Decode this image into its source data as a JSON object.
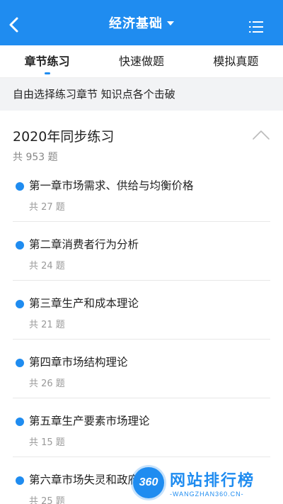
{
  "header": {
    "title": "经济基础"
  },
  "tabs": [
    {
      "label": "章节练习",
      "active": true
    },
    {
      "label": "快速做题",
      "active": false
    },
    {
      "label": "模拟真题",
      "active": false
    }
  ],
  "hint": "自由选择练习章节 知识点各个击破",
  "section": {
    "title": "2020年同步练习",
    "count": "共 953 题"
  },
  "chapters": [
    {
      "title": "第一章市场需求、供给与均衡价格",
      "count": "共 27 题"
    },
    {
      "title": "第二章消费者行为分析",
      "count": "共 24 题"
    },
    {
      "title": "第三章生产和成本理论",
      "count": "共 21 题"
    },
    {
      "title": "第四章市场结构理论",
      "count": "共 26 题"
    },
    {
      "title": "第五章生产要素市场理论",
      "count": "共 15 题"
    },
    {
      "title": "第六章市场失灵和政府的",
      "count": "共 25 题"
    }
  ],
  "watermark": {
    "logo": "360",
    "main": "网站排行榜",
    "sub": "-WANGZHAN360.CN-"
  },
  "colors": {
    "accent": "#1f8cf0"
  }
}
